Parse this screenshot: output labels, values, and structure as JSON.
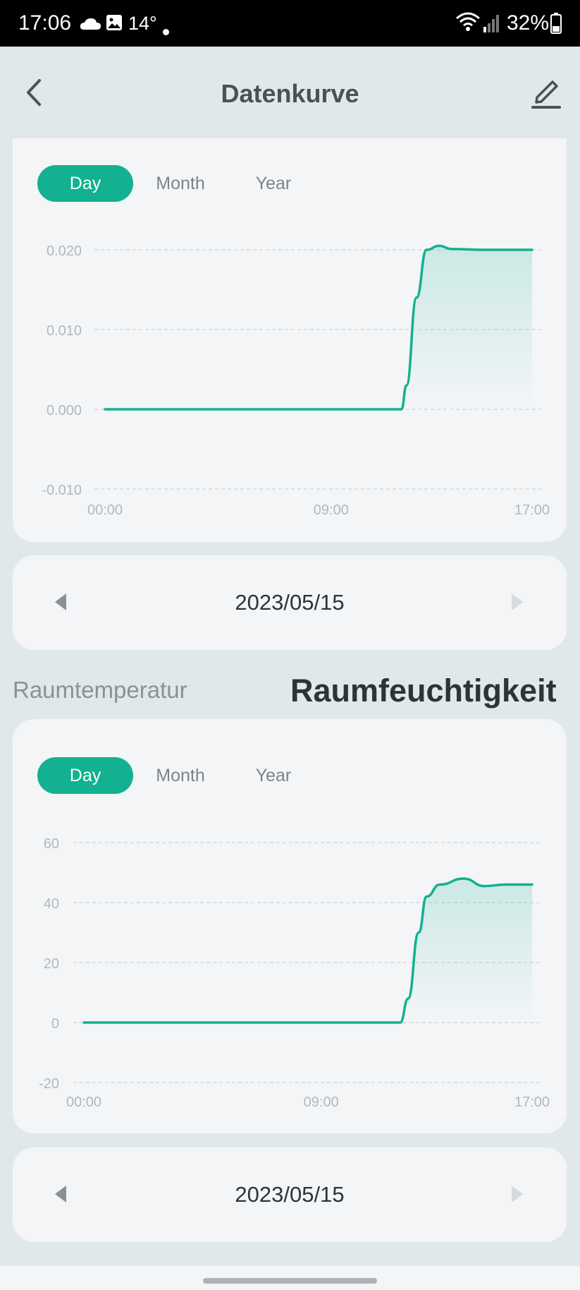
{
  "status_bar": {
    "time": "17:06",
    "temperature": "14°",
    "battery": "32%",
    "icons": [
      "cloud-icon",
      "photo-icon",
      "notification-dot",
      "wifi-icon",
      "signal-icon",
      "battery-icon"
    ]
  },
  "header": {
    "title": "Datenkurve",
    "back_icon": "chevron-left-icon",
    "edit_icon": "edit-pencil-icon"
  },
  "colors": {
    "accent": "#12b18f",
    "background": "#e1e8ec",
    "card": "#f3f5f7"
  },
  "chart1": {
    "periods": [
      "Day",
      "Month",
      "Year"
    ],
    "selected_period": "Day",
    "date": "2023/05/15",
    "chart_data": {
      "type": "area",
      "x_ticks": [
        "00:00",
        "09:00",
        "17:00"
      ],
      "y_ticks": [
        "0.020",
        "0.010",
        "0.000",
        "-0.010"
      ],
      "ylim": [
        -0.01,
        0.02
      ],
      "xlim": [
        0,
        17
      ],
      "grid": true,
      "series": [
        {
          "x": [
            0,
            11.8,
            12.0,
            12.4,
            12.8,
            13.3,
            13.8,
            15.0,
            17.0
          ],
          "y": [
            0,
            0,
            0.003,
            0.014,
            0.02,
            0.0205,
            0.0201,
            0.02,
            0.02
          ]
        }
      ]
    }
  },
  "tabs": {
    "inactive": "Raumtemperatur",
    "active": "Raumfeuchtigkeit"
  },
  "chart2": {
    "periods": [
      "Day",
      "Month",
      "Year"
    ],
    "selected_period": "Day",
    "date": "2023/05/15",
    "chart_data": {
      "type": "area",
      "x_ticks": [
        "00:00",
        "09:00",
        "17:00"
      ],
      "y_ticks": [
        "60",
        "40",
        "20",
        "0",
        "-20"
      ],
      "ylim": [
        -20,
        60
      ],
      "xlim": [
        0,
        17
      ],
      "grid": true,
      "series": [
        {
          "x": [
            0,
            12.0,
            12.3,
            12.7,
            13.0,
            13.5,
            14.4,
            15.2,
            16.0,
            17.0
          ],
          "y": [
            0,
            0,
            8,
            30,
            42,
            46,
            48,
            45.5,
            46,
            46
          ]
        }
      ]
    }
  }
}
